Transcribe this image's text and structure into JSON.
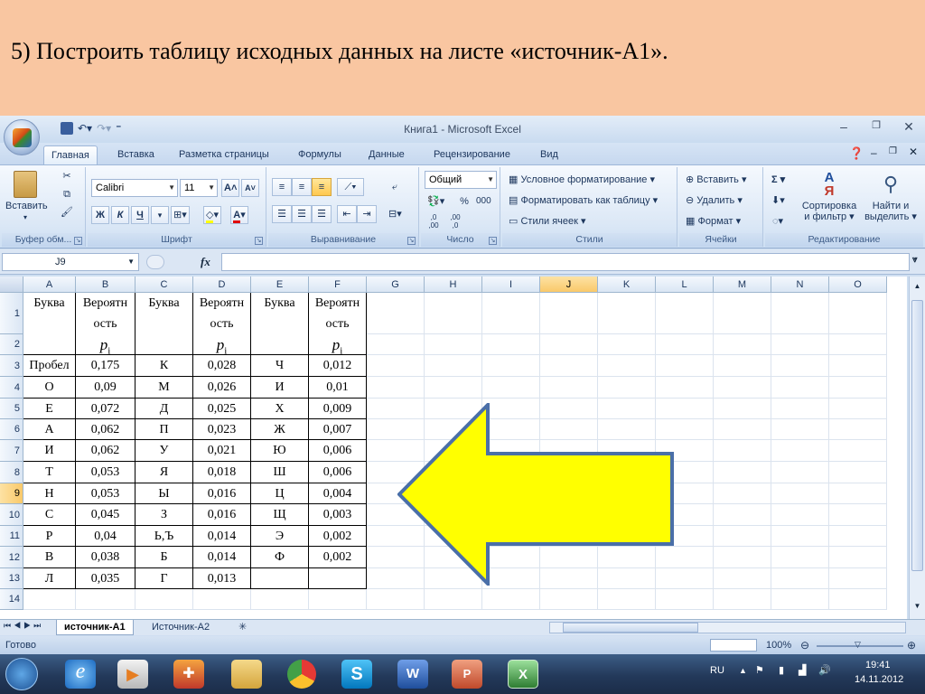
{
  "slide": {
    "title": "5) Построить таблицу исходных данных на листе «источник-А1»."
  },
  "window": {
    "title": "Книга1 - Microsoft Excel"
  },
  "ribbon": {
    "tabs": [
      "Главная",
      "Вставка",
      "Разметка страницы",
      "Формулы",
      "Данные",
      "Рецензирование",
      "Вид"
    ],
    "clipboard": {
      "paste_label": "Вставить",
      "group_label": "Буфер обм..."
    },
    "font": {
      "name": "Calibri",
      "size": "11",
      "bold": "Ж",
      "italic": "К",
      "underline": "Ч",
      "grow": "A",
      "shrink": "A",
      "group_label": "Шрифт"
    },
    "alignment": {
      "group_label": "Выравнивание"
    },
    "number": {
      "format": "Общий",
      "percent": "%",
      "thousands": "000",
      "group_label": "Число"
    },
    "styles": {
      "conditional": "Условное форматирование",
      "as_table": "Форматировать как таблицу",
      "cell_styles": "Стили ячеек",
      "group_label": "Стили"
    },
    "cells": {
      "insert": "Вставить",
      "delete": "Удалить",
      "format": "Формат",
      "group_label": "Ячейки"
    },
    "editing": {
      "sigma": "Σ",
      "sort_line1": "Сортировка",
      "sort_line2": "и фильтр",
      "find_line1": "Найти и",
      "find_line2": "выделить",
      "group_label": "Редактирование"
    }
  },
  "formula_bar": {
    "name_box": "J9",
    "fx": "fx",
    "value": ""
  },
  "grid": {
    "columns": [
      "A",
      "B",
      "C",
      "D",
      "E",
      "F",
      "G",
      "H",
      "I",
      "J",
      "K",
      "L",
      "M",
      "N",
      "O"
    ],
    "selected_column": "J",
    "rows": [
      "1",
      "2",
      "3",
      "4",
      "5",
      "6",
      "7",
      "8",
      "9",
      "10",
      "11",
      "12",
      "13",
      "14"
    ],
    "selected_row": "9"
  },
  "table": {
    "headers": {
      "letter": "Буква",
      "prob_line1": "Вероятн",
      "prob_line2": "ость",
      "pi_symbol": "p",
      "pi_sub": "i"
    },
    "rows": [
      [
        "Пробел",
        "0,175",
        "К",
        "0,028",
        "Ч",
        "0,012"
      ],
      [
        "О",
        "0,09",
        "М",
        "0,026",
        "И",
        "0,01"
      ],
      [
        "Е",
        "0,072",
        "Д",
        "0,025",
        "Х",
        "0,009"
      ],
      [
        "А",
        "0,062",
        "П",
        "0,023",
        "Ж",
        "0,007"
      ],
      [
        "И",
        "0,062",
        "У",
        "0,021",
        "Ю",
        "0,006"
      ],
      [
        "Т",
        "0,053",
        "Я",
        "0,018",
        "Ш",
        "0,006"
      ],
      [
        "Н",
        "0,053",
        "Ы",
        "0,016",
        "Ц",
        "0,004"
      ],
      [
        "С",
        "0,045",
        "З",
        "0,016",
        "Щ",
        "0,003"
      ],
      [
        "Р",
        "0,04",
        "Ь,Ъ",
        "0,014",
        "Э",
        "0,002"
      ],
      [
        "В",
        "0,038",
        "Б",
        "0,014",
        "Ф",
        "0,002"
      ],
      [
        "Л",
        "0,035",
        "Г",
        "0,013",
        "",
        ""
      ]
    ]
  },
  "sheets": {
    "tabs": [
      "источник-А1",
      "Источник-А2"
    ],
    "active": "источник-А1"
  },
  "status": {
    "ready": "Готово",
    "zoom": "100%"
  },
  "taskbar": {
    "lang": "RU",
    "time": "19:41",
    "date": "14.11.2012"
  },
  "colors": {
    "arrow_fill": "#ffff00",
    "arrow_stroke": "#4a6fa8",
    "slide_bg": "#f9c6a1",
    "selected_header": "#f9c96a"
  }
}
